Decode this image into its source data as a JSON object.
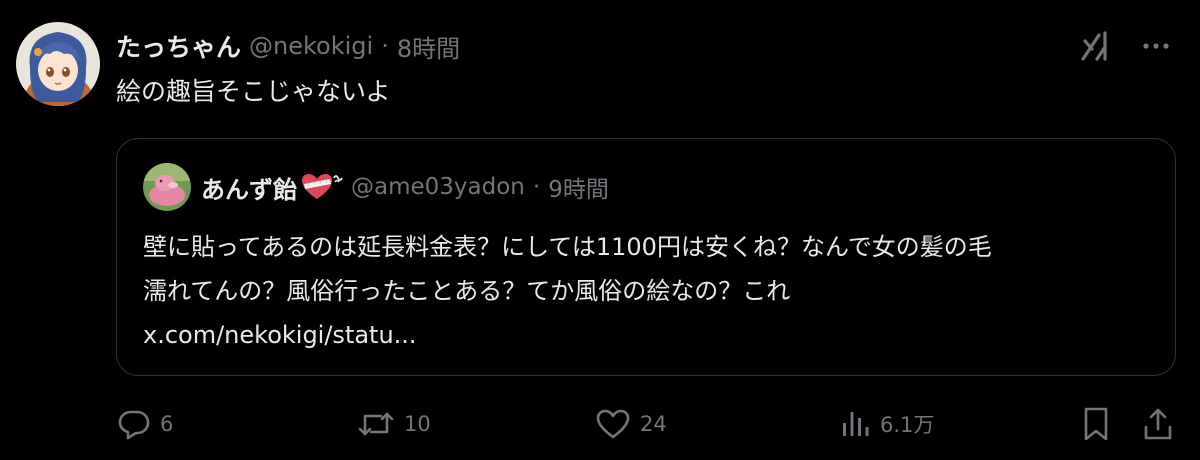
{
  "tweet": {
    "display_name": "たっちゃん",
    "handle": "@nekokigi",
    "separator": "·",
    "time": "8時間",
    "text": "絵の趣旨そこじゃないよ"
  },
  "quote": {
    "display_name": "あんず飴",
    "handle": "@ame03yadon",
    "separator": "·",
    "time": "9時間",
    "lines": [
      "壁に貼ってあるのは延長料金表？にしては1100円は安くね？なんで女の髪の毛",
      "濡れてんの？風俗行ったことある？てか風俗の絵なの？これ",
      "x.com/nekokigi/statu..."
    ]
  },
  "actions": {
    "replies": "6",
    "reposts": "10",
    "likes": "24",
    "views": "6.1万"
  },
  "icons": {
    "grok": "grok-icon",
    "more": "more-icon",
    "reply": "reply-icon",
    "repost": "repost-icon",
    "like": "heart-icon",
    "views": "views-icon",
    "bookmark": "bookmark-icon",
    "share": "share-icon"
  },
  "colors": {
    "background": "#000000",
    "text": "#e7e9ea",
    "secondary": "#71767b",
    "border": "#2f3336"
  }
}
